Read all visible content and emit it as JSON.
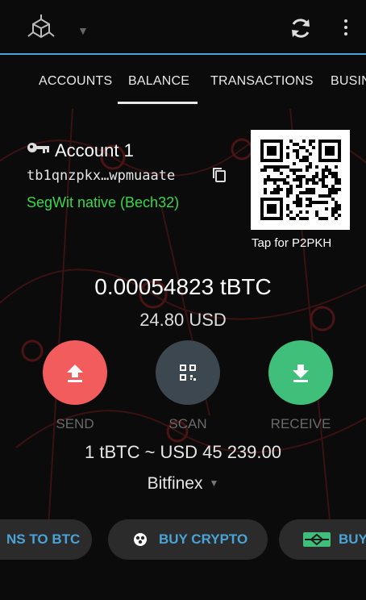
{
  "tabs": [
    "ACCOUNTS",
    "BALANCE",
    "TRANSACTIONS",
    "BUSIN"
  ],
  "account": {
    "name": "Account 1",
    "address": "tb1qnzpkx…wpmuaate",
    "address_type": "SegWit native (Bech32)",
    "qr_hint": "Tap for P2PKH"
  },
  "balance": {
    "amount": "0.00054823 tBTC",
    "fiat": "24.80 USD"
  },
  "actions": {
    "send": "SEND",
    "scan": "SCAN",
    "receive": "RECEIVE"
  },
  "rate": "1 tBTC ~ USD 45 239.00",
  "exchange": "Bitfinex",
  "quick_actions": {
    "convert": "NS TO BTC",
    "buy_crypto": "BUY CRYPTO",
    "buy_other": "BUY"
  },
  "colors": {
    "accent": "#4aa3d6",
    "send": "#f25c5c",
    "scan": "#3c4750",
    "receive": "#3fbf7a",
    "segwit": "#37d84a"
  },
  "icons": {
    "logo": "crypto-network-logo-icon",
    "refresh": "refresh-icon",
    "more": "more-vertical-icon",
    "account": "keys-icon",
    "copy": "copy-icon",
    "send": "upload-arrow-icon",
    "scan": "qr-scan-icon",
    "receive": "download-arrow-icon"
  }
}
